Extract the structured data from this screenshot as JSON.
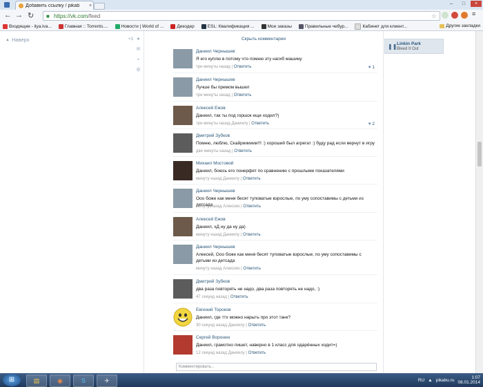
{
  "browser": {
    "tab_title": "Добавить ссылку / pikab",
    "tab_close": "×",
    "url_host": "https://vk.com",
    "url_path": "/feed",
    "bookmarks": [
      {
        "label": "Входящие - ilya.lva...",
        "color": "#d33"
      },
      {
        "label": "Главная :: Torrents....",
        "color": "#c33"
      },
      {
        "label": "Новости | World of ...",
        "color": "#2a6"
      },
      {
        "label": "Декодер",
        "color": "#c22"
      },
      {
        "label": "ESL: Квалификация ...",
        "color": "#234"
      },
      {
        "label": "Мои заказы",
        "color": "#333"
      },
      {
        "label": "Правильные чебур...",
        "color": "#556"
      },
      {
        "label": "Кабинет для клиент...",
        "color": "#ddd"
      }
    ],
    "other_bookmarks": "Другие закладки"
  },
  "sidebar": {
    "up_label": "Наверх",
    "count": "+1"
  },
  "feed": {
    "hide_comments": "Скрыть комментарии",
    "composer_placeholder": "Комментировать...",
    "comments": [
      {
        "name": "Даниил Чернышев",
        "text": "Я его куплю в потому что помню эту нагиб машину",
        "time": "три минуты назад",
        "reply_to": "",
        "reply": "Ответить",
        "likes": "1",
        "avatar": "#8a9aa6"
      },
      {
        "name": "Даниил Чернышев",
        "text": "Лучше бы премом вышел",
        "time": "три минуты назад",
        "reply_to": "",
        "reply": "Ответить",
        "likes": "",
        "avatar": "#8a9aa6"
      },
      {
        "name": "Алексей Ежов",
        "text": "Даниил, так ты под горшок еще ходил?)",
        "time": "три минуты назад",
        "reply_to": "Даниилу",
        "reply": "Ответить",
        "likes": "2",
        "avatar": "#6d5a4a"
      },
      {
        "name": "Дмитрий Зубков",
        "text": "Помню, люблю, Скайрииииии!!! :) хороший был агрегат :) буду рад если вернут в игру",
        "time": "две минуты назад",
        "reply_to": "",
        "reply": "Ответить",
        "likes": "",
        "avatar": "#5c5c5c"
      },
      {
        "name": "Михаил Мостовой",
        "text": "Даниил, боюсь его понерфят по сравнению с прошлыми показателями",
        "time": "минуту назад",
        "reply_to": "Даниилу",
        "reply": "Ответить",
        "likes": "",
        "avatar": "#3a2a24"
      },
      {
        "name": "Даниил Чернышев",
        "text": "Ооо боже как меня бесят туповатые взрослые, по уму сопоставимы с детьми из детсада",
        "time": "минуту назад",
        "reply_to": "Алексею",
        "reply": "Ответить",
        "likes": "",
        "avatar": "#8a9aa6"
      },
      {
        "name": "Алексей Ежов",
        "text": "Даниил, хД ну да ну да)",
        "time": "минуту назад",
        "reply_to": "Даниилу",
        "reply": "Ответить",
        "likes": "",
        "avatar": "#6d5a4a"
      },
      {
        "name": "Даниил Чернышев",
        "text": "Алексей, Ооо боже как меня бесят туповатые взрослые, по уму сопоставимы с детьми из детсада",
        "time": "минуту назад",
        "reply_to": "Алексею",
        "reply": "Ответить",
        "likes": "",
        "avatar": "#8a9aa6"
      },
      {
        "name": "Дмитрий Зубков",
        "text": "два раза повторять не надо, два раза повторять не надо, :)",
        "time": "47 секунд назад",
        "reply_to": "",
        "reply": "Ответить",
        "likes": "",
        "avatar": "#5c5c5c"
      },
      {
        "name": "Евгений Тороков",
        "text": "Даниил, где ттх можно нарыть про этот танк?",
        "time": "30 секунд назад",
        "reply_to": "Даниилу",
        "reply": "Ответить",
        "likes": "",
        "avatar": "#f2d640"
      },
      {
        "name": "Сергей Воронин",
        "text": "Даниил, грамотно пишет, наверно в 1 класс для одарённых ходит=)",
        "time": "12 секунд назад",
        "reply_to": "Даниилу",
        "reply": "Ответить",
        "likes": "",
        "avatar": "#b33a2e"
      }
    ]
  },
  "player": {
    "artist": "Linkin Park",
    "song": "Bleed It Out"
  },
  "taskbar": {
    "lang": "RU",
    "time": "1:07",
    "date": "08.01.2014",
    "watermark": "pikabu.ru"
  }
}
